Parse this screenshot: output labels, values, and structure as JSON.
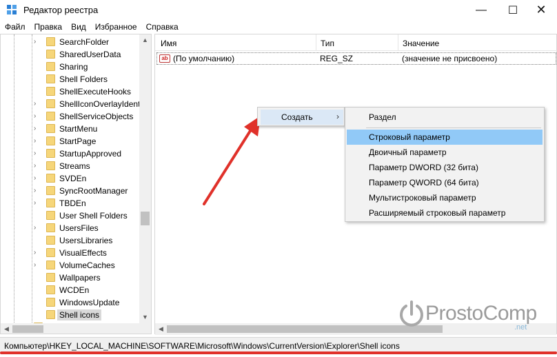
{
  "window": {
    "title": "Редактор реестра",
    "minimize_glyph": "—",
    "maximize_glyph": "☐",
    "close_glyph": "✕"
  },
  "menu": [
    "Файл",
    "Правка",
    "Вид",
    "Избранное",
    "Справка"
  ],
  "tree": {
    "items": [
      "SearchFolder",
      "SharedUserData",
      "Sharing",
      "Shell Folders",
      "ShellExecuteHooks",
      "ShellIconOverlayIdent",
      "ShellServiceObjects",
      "StartMenu",
      "StartPage",
      "StartupApproved",
      "Streams",
      "SVDEn",
      "SyncRootManager",
      "TBDEn",
      "User Shell Folders",
      "UsersFiles",
      "UsersLibraries",
      "VisualEffects",
      "VolumeCaches",
      "Wallpapers",
      "WCDEn",
      "WindowsUpdate",
      "Shell icons"
    ],
    "expandable": [
      true,
      false,
      false,
      false,
      false,
      true,
      true,
      true,
      true,
      true,
      true,
      true,
      true,
      true,
      false,
      true,
      false,
      true,
      true,
      false,
      false,
      false,
      false
    ],
    "selected_index": 22
  },
  "list": {
    "columns": [
      "Имя",
      "Тип",
      "Значение"
    ],
    "rows": [
      {
        "icon": "ab",
        "name": "(По умолчанию)",
        "type": "REG_SZ",
        "value": "(значение не присвоено)"
      }
    ]
  },
  "context_menu": {
    "create_label": "Создать",
    "submenu_arrow": "›",
    "submenu": [
      "Раздел",
      "Строковый параметр",
      "Двоичный параметр",
      "Параметр DWORD (32 бита)",
      "Параметр QWORD (64 бита)",
      "Мультистроковый параметр",
      "Расширяемый строковый параметр"
    ],
    "highlighted_index": 1
  },
  "status": {
    "path": "Компьютер\\HKEY_LOCAL_MACHINE\\SOFTWARE\\Microsoft\\Windows\\CurrentVersion\\Explorer\\Shell icons"
  },
  "watermark": {
    "brand": "ProstoComp",
    "domain": ".net"
  },
  "colors": {
    "highlight": "#91c9f7",
    "annotation_red": "#e0312a",
    "folder": "#f6d67a"
  }
}
